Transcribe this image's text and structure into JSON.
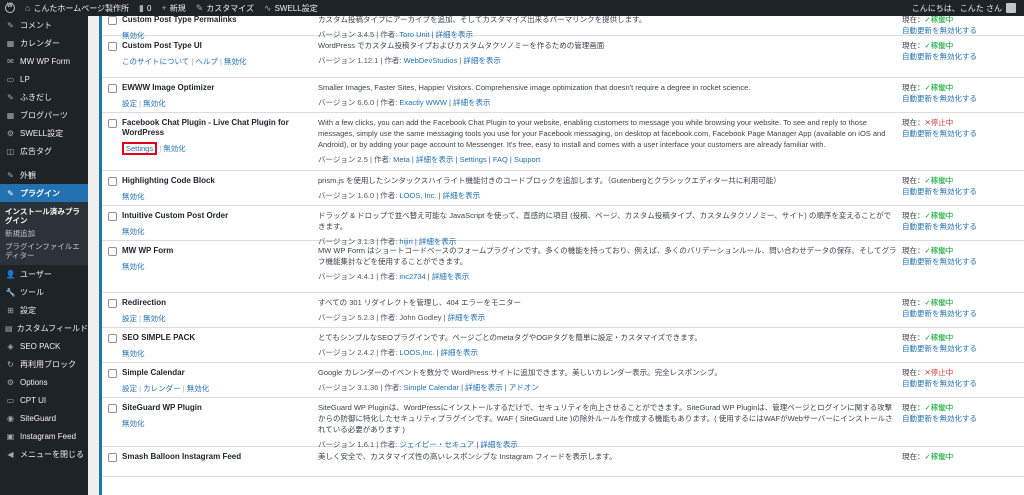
{
  "adminbar": {
    "site_name": "こんたホームページ製作所",
    "comments_count": "0",
    "new_label": "新規",
    "customize_label": "カスタマイズ",
    "swell_label": "SWELL設定",
    "greeting": "こんにちは、こんた さん"
  },
  "sidebar": {
    "items": [
      {
        "icon": "✎",
        "label": "コメント"
      },
      {
        "icon": "▦",
        "label": "カレンダー"
      },
      {
        "icon": "✉",
        "label": "MW WP Form"
      },
      {
        "icon": "▭",
        "label": "LP"
      },
      {
        "icon": "✎",
        "label": "ふきだし"
      },
      {
        "icon": "▦",
        "label": "ブログパーツ"
      },
      {
        "icon": "⚙",
        "label": "SWELL設定"
      },
      {
        "icon": "◫",
        "label": "広告タグ"
      },
      {
        "icon": "✎",
        "label": "外観"
      },
      {
        "icon": "✎",
        "label": "プラグイン"
      }
    ],
    "submenu": [
      {
        "label": "インストール済みプラグイン"
      },
      {
        "label": "新規追加"
      },
      {
        "label": "プラグインファイルエディター"
      }
    ],
    "items_after": [
      {
        "icon": "👤",
        "label": "ユーザー"
      },
      {
        "icon": "🔧",
        "label": "ツール"
      },
      {
        "icon": "⊞",
        "label": "設定"
      },
      {
        "icon": "▤",
        "label": "カスタムフィールド"
      },
      {
        "icon": "◈",
        "label": "SEO PACK"
      },
      {
        "icon": "↻",
        "label": "再利用ブロック"
      },
      {
        "icon": "⚙",
        "label": "Options"
      },
      {
        "icon": "▭",
        "label": "CPT UI"
      },
      {
        "icon": "◉",
        "label": "SiteGuard"
      },
      {
        "icon": "▣",
        "label": "Instagram Feed"
      },
      {
        "icon": "◀",
        "label": "メニューを閉じる"
      }
    ]
  },
  "plugins": [
    {
      "name": "Custom Post Type Permalinks",
      "actions": [
        "無効化"
      ],
      "description": "カスタム投稿タイプにアーカイブを追加、そしてカスタマイズ出来るパーマリンクを提供します。",
      "meta_prefix": "バージョン 3.4.5 | 作者: ",
      "author": "Toro Unit",
      "meta_links": [
        "詳細を表示"
      ],
      "status_label": "現在：",
      "status": "✓稼働中",
      "status_class": "on",
      "auto_update": "自動更新を無効化する"
    },
    {
      "name": "Custom Post Type UI",
      "actions": [
        "このサイトについて",
        "ヘルプ",
        "無効化"
      ],
      "description": "WordPress でカスタム投稿タイプおよびカスタムタクソノミーを作るための管理画面",
      "meta_prefix": "バージョン 1.12.1 | 作者: ",
      "author": "WebDevStudios",
      "meta_links": [
        "詳細を表示"
      ],
      "status_label": "現在：",
      "status": "✓稼働中",
      "status_class": "on",
      "auto_update": "自動更新を無効化する"
    },
    {
      "name": "EWWW Image Optimizer",
      "actions": [
        "設定",
        "無効化"
      ],
      "description": "Smaller Images, Faster Sites, Happier Visitors. Comprehensive image optimization that doesn't require a degree in rocket science.",
      "meta_prefix": "バージョン 6.6.0 | 作者: ",
      "author": "Exactly WWW",
      "meta_links": [
        "詳細を表示"
      ],
      "status_label": "現在：",
      "status": "✓稼働中",
      "status_class": "on",
      "auto_update": "自動更新を無効化する"
    },
    {
      "name": "Facebook Chat Plugin - Live Chat Plugin for WordPress",
      "actions": [
        "Settings",
        "無効化"
      ],
      "description": "With a few clicks, you can add the Facebook Chat Plugin to your website, enabling customers to message you while browsing your website. To see and reply to those messages, simply use the same messaging tools you use for your Facebook messaging, on desktop at facebook.com, Facebook Page Manager App (available on iOS and Android), or by adding your page account to Messenger. It's free, easy to install and comes with a user interface your customers are already familiar with.",
      "meta_prefix": "バージョン 2.5 | 作者: ",
      "author": "Meta",
      "meta_links": [
        "詳細を表示",
        "Settings",
        "FAQ",
        "Support"
      ],
      "status_label": "現在：",
      "status": "✕停止中",
      "status_class": "off",
      "auto_update": "自動更新を無効化する"
    },
    {
      "name": "Highlighting Code Block",
      "actions": [
        "無効化"
      ],
      "description": "prism.js を使用したシンタックスハイライト機能付きのコードブロックを追加します。（Gutenbergとクラシックエディター共に利用可能）",
      "meta_prefix": "バージョン 1.6.0 | 作者: ",
      "author": "LOOS, Inc.",
      "meta_links": [
        "詳細を表示"
      ],
      "status_label": "現在：",
      "status": "✓稼働中",
      "status_class": "on",
      "auto_update": "自動更新を無効化する"
    },
    {
      "name": "Intuitive Custom Post Order",
      "actions": [
        "無効化"
      ],
      "description": "ドラッグ & ドロップで並べ替え可能な JavaScript を使って、直感的に項目 (投稿、ページ、カスタム投稿タイプ、カスタムタクソノミー、サイト) の順序を変えることができます。",
      "meta_prefix": "バージョン 3.1.3 | 作者: ",
      "author": "hijiri",
      "meta_links": [
        "詳細を表示"
      ],
      "status_label": "現在：",
      "status": "✓稼働中",
      "status_class": "on",
      "auto_update": "自動更新を無効化する"
    },
    {
      "name": "MW WP Form",
      "actions": [
        "無効化"
      ],
      "description": "MW WP Form はショートコードベースのフォームプラグインです。多くの機能を持っており、例えば、多くのバリデーションルール、問い合わせデータの保存、そしてグラフ機能集計などを使用することができます。",
      "meta_prefix": "バージョン 4.4.1 | 作者: ",
      "author": "inc2734",
      "meta_links": [
        "詳細を表示"
      ],
      "status_label": "現在：",
      "status": "✓稼働中",
      "status_class": "on",
      "auto_update": "自動更新を無効化する"
    },
    {
      "name": "Redirection",
      "actions": [
        "設定",
        "無効化"
      ],
      "description": "すべての 301 リダイレクトを管理し、404 エラーをモニター",
      "meta_prefix": "バージョン 5.2.3 | 作者: John Godley | ",
      "author": "",
      "meta_links": [
        "詳細を表示"
      ],
      "status_label": "現在：",
      "status": "✓稼働中",
      "status_class": "on",
      "auto_update": "自動更新を無効化する"
    },
    {
      "name": "SEO SIMPLE PACK",
      "actions": [
        "無効化"
      ],
      "description": "とてもシンプルなSEOプラグインです。ページごとのmetaタグやOGPタグを簡単に設定・カスタマイズできます。",
      "meta_prefix": "バージョン 2.4.2 | 作者: ",
      "author": "LOOS,Inc.",
      "meta_links": [
        "詳細を表示"
      ],
      "status_label": "現在：",
      "status": "✓稼働中",
      "status_class": "on",
      "auto_update": "自動更新を無効化する"
    },
    {
      "name": "Simple Calendar",
      "actions": [
        "設定",
        "カレンダー",
        "無効化"
      ],
      "description": "Google カレンダーのイベントを数分で WordPress サイトに追加できます。美しいカレンダー表示。完全レスポンシブ。",
      "meta_prefix": "バージョン 3.1.36 | 作者: ",
      "author": "Simple Calendar",
      "meta_links": [
        "詳細を表示",
        "アドオン"
      ],
      "status_label": "現在：",
      "status": "✕停止中",
      "status_class": "off",
      "auto_update": "自動更新を無効化する"
    },
    {
      "name": "SiteGuard WP Plugin",
      "actions": [
        "無効化"
      ],
      "description": "SiteGuard WP Pluginは、WordPressにインストールするだけで、セキュリティを向上させることができます。SiteGurad WP Pluginは、管理ページとログインに関する攻撃からの防御に特化したセキュリティプラグインです。WAF ( SiteGuard Lite )の除外ルールを作成する機能もあります。( 使用するにはWAFがWebサーバーにインストールされている必要があります )",
      "meta_prefix": "バージョン 1.6.1 | 作者: ",
      "author": "ジェイピー・セキュア",
      "meta_links": [
        "詳細を表示"
      ],
      "status_label": "現在：",
      "status": "✓稼働中",
      "status_class": "on",
      "auto_update": "自動更新を無効化する"
    },
    {
      "name": "Smash Balloon Instagram Feed",
      "actions": [],
      "description": "美しく安全で、カスタマイズ性の高いレスポンシブな Instagram フィードを表示します。",
      "meta_prefix": "",
      "author": "",
      "meta_links": [],
      "status_label": "現在：",
      "status": "✓稼働中",
      "status_class": "on",
      "auto_update": ""
    }
  ]
}
